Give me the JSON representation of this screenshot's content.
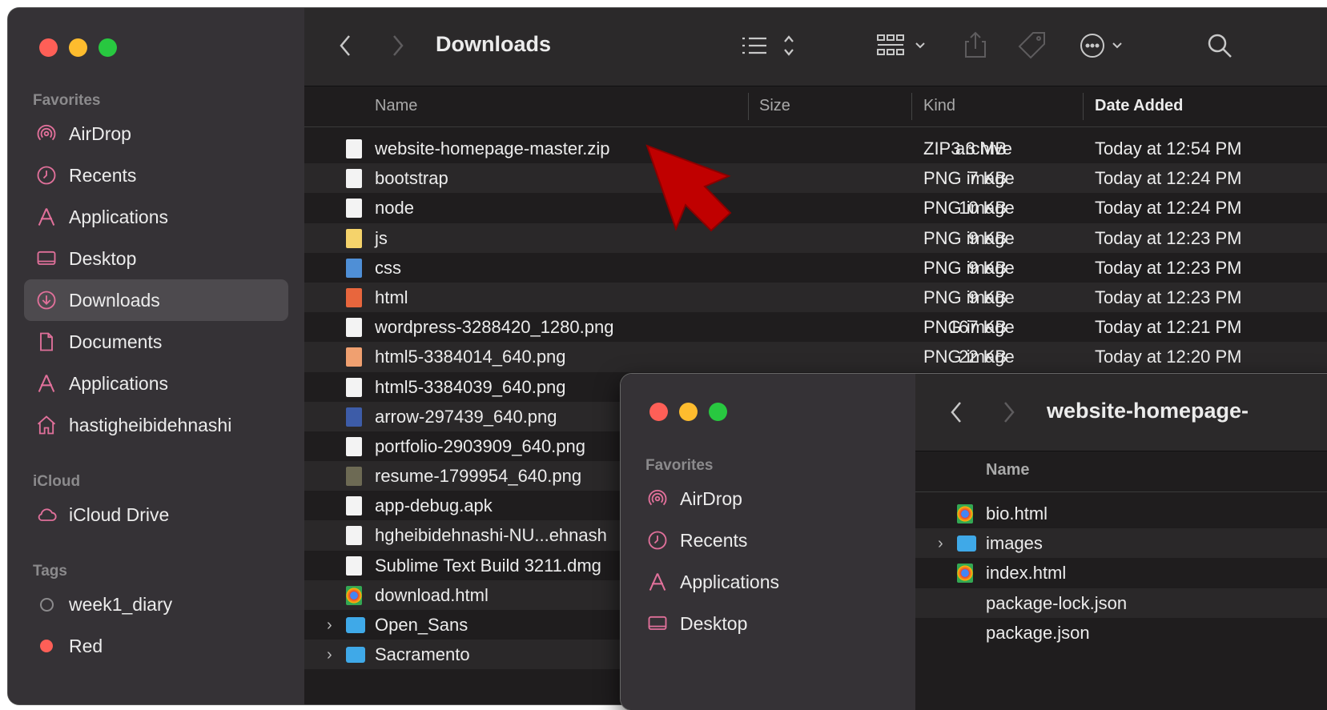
{
  "window": {
    "title": "Downloads",
    "sidebar": {
      "favorites_label": "Favorites",
      "icloud_label": "iCloud",
      "tags_label": "Tags",
      "items": [
        {
          "label": "AirDrop",
          "icon": "airdrop-icon"
        },
        {
          "label": "Recents",
          "icon": "clock-icon"
        },
        {
          "label": "Applications",
          "icon": "applications-icon"
        },
        {
          "label": "Desktop",
          "icon": "desktop-icon"
        },
        {
          "label": "Downloads",
          "icon": "download-icon",
          "active": true
        },
        {
          "label": "Documents",
          "icon": "document-icon"
        },
        {
          "label": "Applications",
          "icon": "applications-icon"
        },
        {
          "label": "hastigheibidehnashi",
          "icon": "home-icon"
        }
      ],
      "icloud_items": [
        {
          "label": "iCloud Drive",
          "icon": "cloud-icon"
        }
      ],
      "tags": [
        {
          "label": "week1_diary",
          "color": "#8b8a8c"
        },
        {
          "label": "Red",
          "color": "#fe5f57"
        }
      ]
    },
    "columns": {
      "name": "Name",
      "size": "Size",
      "kind": "Kind",
      "date": "Date Added"
    },
    "files": [
      {
        "name": "website-homepage-master.zip",
        "size": "3.3 MB",
        "kind": "ZIP archive",
        "date": "Today at 12:54 PM",
        "icon": "zip-icon"
      },
      {
        "name": "bootstrap",
        "size": "7 KB",
        "kind": "PNG image",
        "date": "Today at 12:24 PM",
        "icon": "image-icon"
      },
      {
        "name": "node",
        "size": "10 KB",
        "kind": "PNG image",
        "date": "Today at 12:24 PM",
        "icon": "image-icon"
      },
      {
        "name": "js",
        "size": "9 KB",
        "kind": "PNG image",
        "date": "Today at 12:23 PM",
        "icon": "image-icon"
      },
      {
        "name": "css",
        "size": "9 KB",
        "kind": "PNG image",
        "date": "Today at 12:23 PM",
        "icon": "image-icon"
      },
      {
        "name": "html",
        "size": "9 KB",
        "kind": "PNG image",
        "date": "Today at 12:23 PM",
        "icon": "image-icon"
      },
      {
        "name": "wordpress-3288420_1280.png",
        "size": "167 KB",
        "kind": "PNG image",
        "date": "Today at 12:21 PM",
        "icon": "image-icon"
      },
      {
        "name": "html5-3384014_640.png",
        "size": "22 KB",
        "kind": "PNG image",
        "date": "Today at 12:20 PM",
        "icon": "image-icon"
      },
      {
        "name": "html5-3384039_640.png",
        "size": "",
        "kind": "",
        "date": "",
        "icon": "image-icon"
      },
      {
        "name": "arrow-297439_640.png",
        "size": "",
        "kind": "",
        "date": "",
        "icon": "image-icon"
      },
      {
        "name": "portfolio-2903909_640.png",
        "size": "",
        "kind": "",
        "date": "",
        "icon": "image-icon"
      },
      {
        "name": "resume-1799954_640.png",
        "size": "",
        "kind": "",
        "date": "",
        "icon": "image-icon"
      },
      {
        "name": "app-debug.apk",
        "size": "",
        "kind": "",
        "date": "",
        "icon": "document-icon"
      },
      {
        "name": "hgheibidehnashi-NU...ehnash",
        "size": "",
        "kind": "",
        "date": "",
        "icon": "document-icon"
      },
      {
        "name": "Sublime Text Build 3211.dmg",
        "size": "",
        "kind": "",
        "date": "",
        "icon": "disk-image-icon"
      },
      {
        "name": "download.html",
        "size": "",
        "kind": "",
        "date": "",
        "icon": "chrome-html-icon"
      },
      {
        "name": "Open_Sans",
        "size": "",
        "kind": "",
        "date": "",
        "icon": "folder-icon",
        "folder": true
      },
      {
        "name": "Sacramento",
        "size": "",
        "kind": "",
        "date": "",
        "icon": "folder-icon",
        "folder": true
      }
    ]
  },
  "window2": {
    "title": "website-homepage-",
    "favorites_label": "Favorites",
    "sidebar_items": [
      {
        "label": "AirDrop",
        "icon": "airdrop-icon"
      },
      {
        "label": "Recents",
        "icon": "clock-icon"
      },
      {
        "label": "Applications",
        "icon": "applications-icon"
      },
      {
        "label": "Desktop",
        "icon": "desktop-icon"
      }
    ],
    "name_header": "Name",
    "files": [
      {
        "name": "bio.html",
        "icon": "chrome-html-icon"
      },
      {
        "name": "images",
        "icon": "folder-icon",
        "folder": true
      },
      {
        "name": "index.html",
        "icon": "chrome-html-icon"
      },
      {
        "name": "package-lock.json",
        "icon": ""
      },
      {
        "name": "package.json",
        "icon": ""
      }
    ]
  },
  "annotation": {
    "color": "#c00000"
  }
}
